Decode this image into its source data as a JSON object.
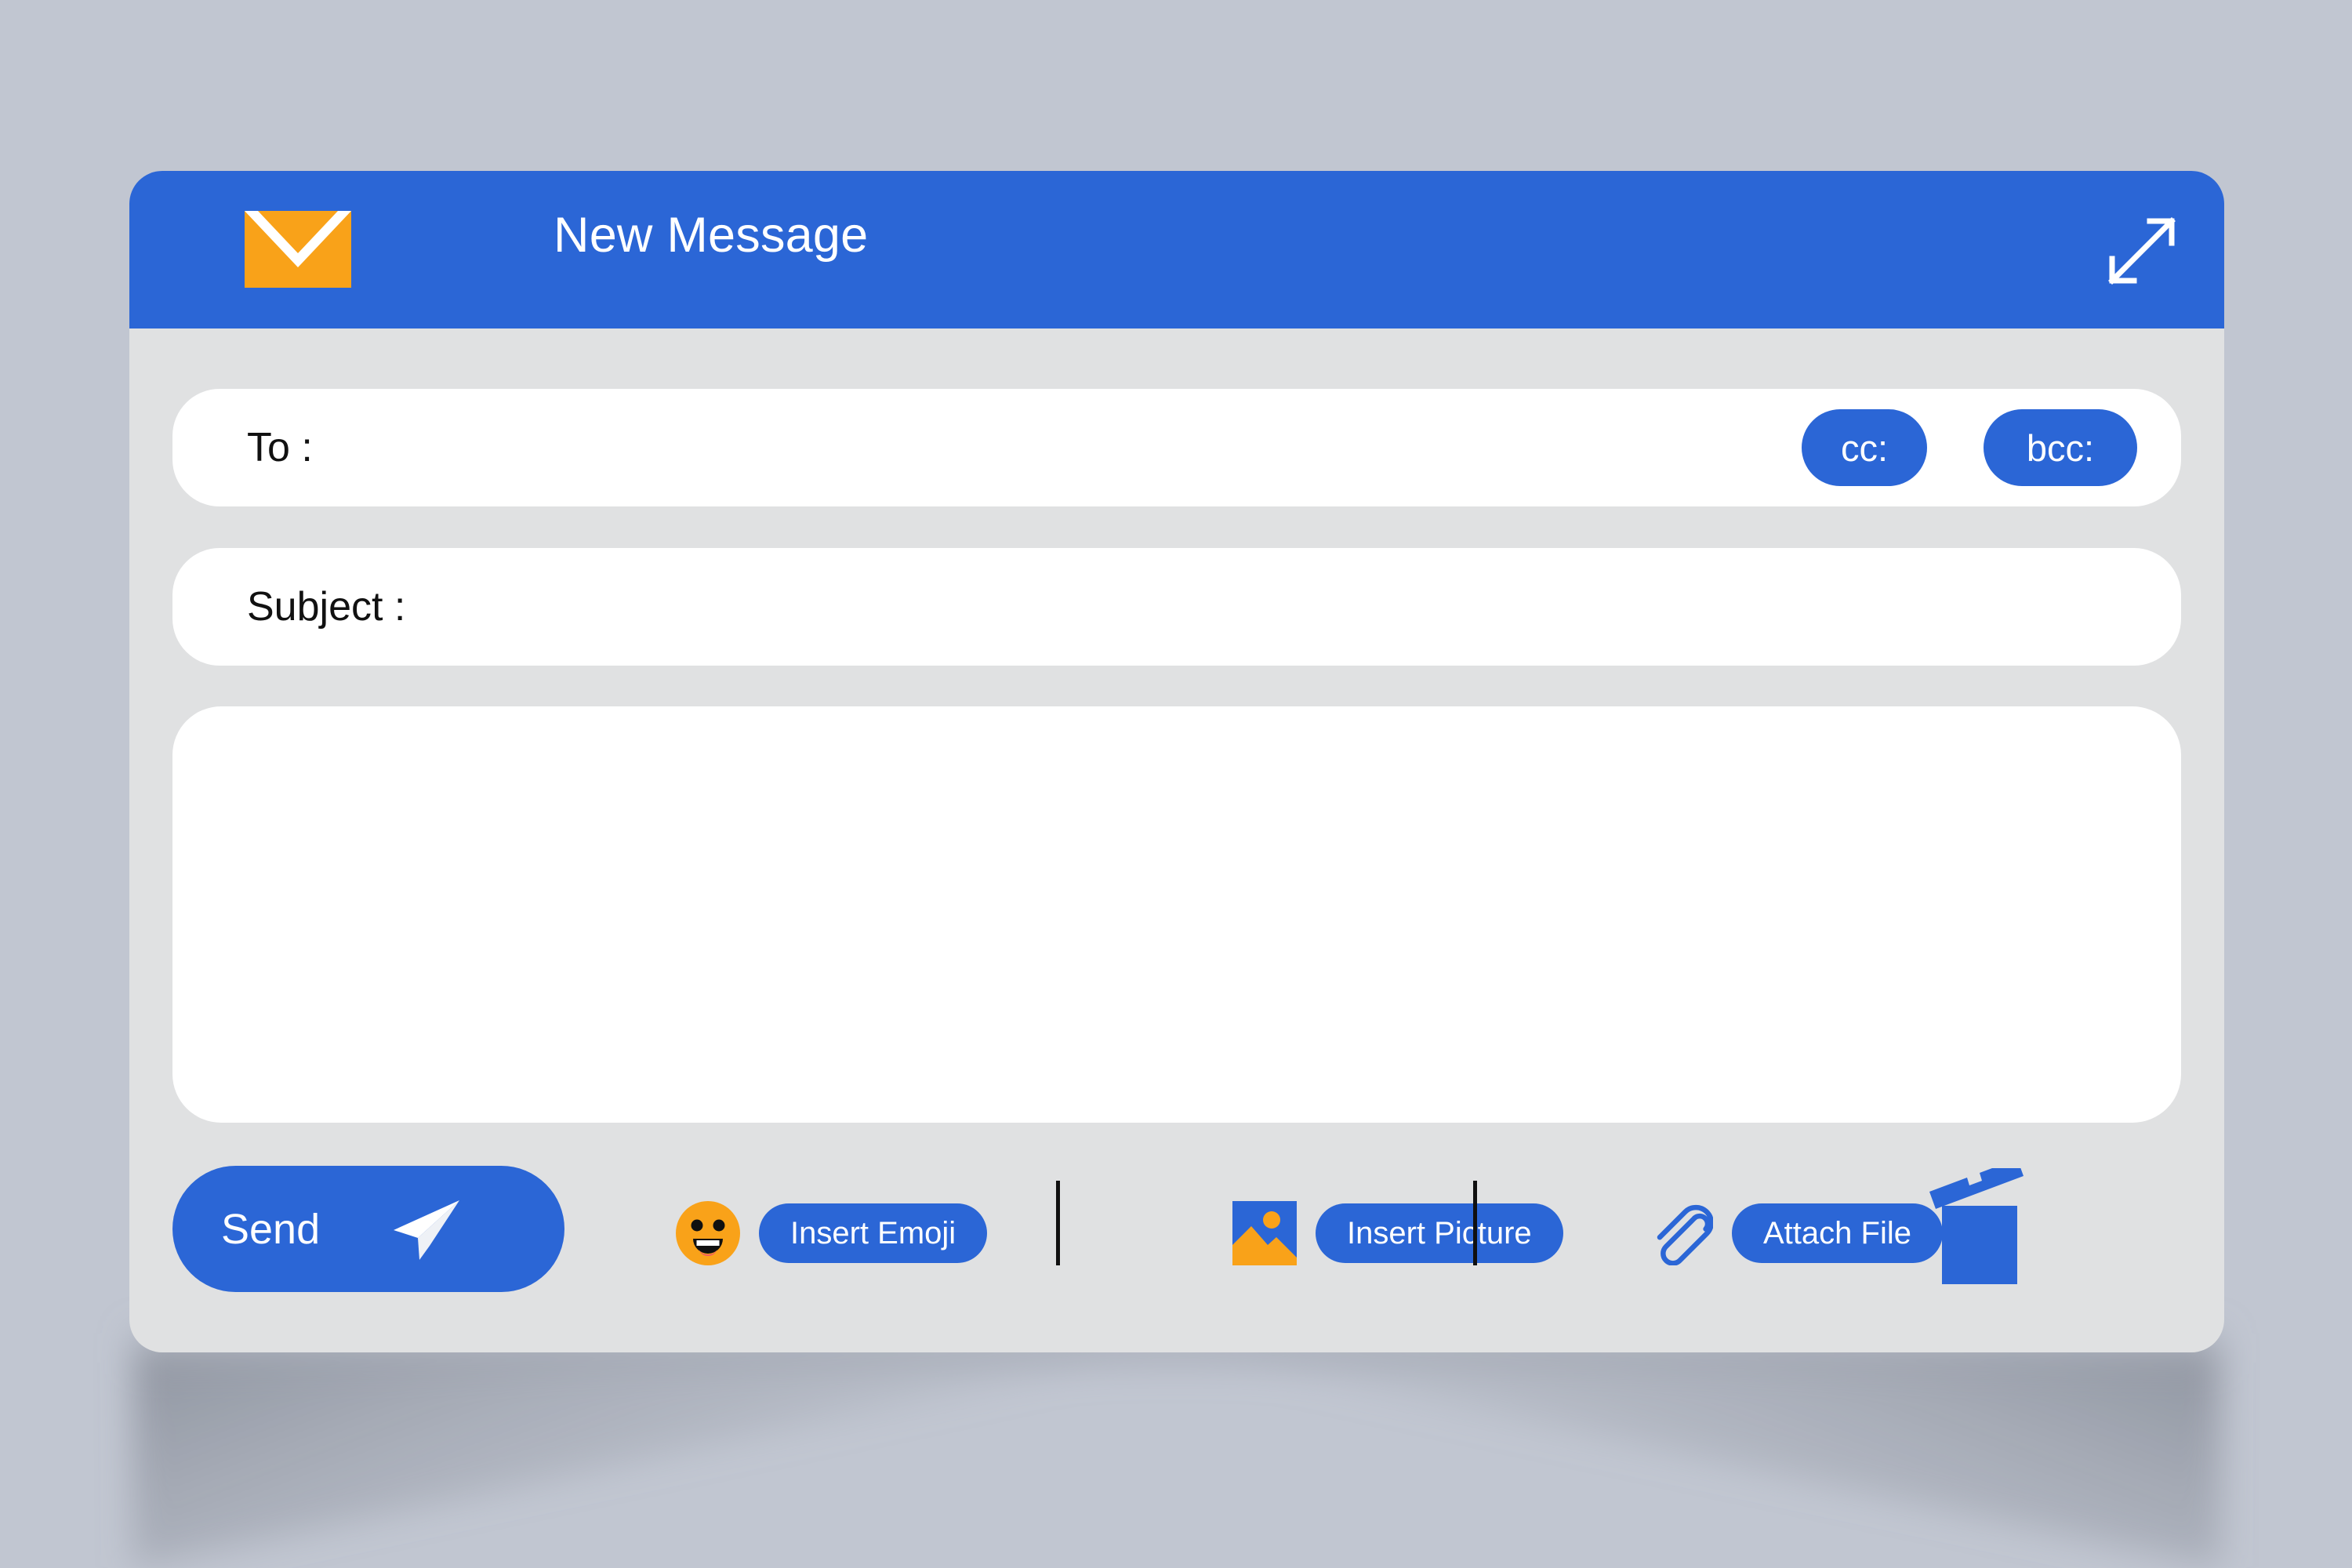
{
  "theme": {
    "page_background": "#c1c6d1",
    "window_background": "#e0e1e2",
    "accent_blue": "#2b66d6",
    "accent_orange": "#f9a219",
    "field_white": "#ffffff",
    "text_dark": "#111111",
    "text_light": "#ffffff",
    "divider": "#101010"
  },
  "titlebar": {
    "title": "New Message",
    "envelope_icon": "envelope-icon",
    "expand_icon": "expand-arrows-icon"
  },
  "form": {
    "to": {
      "label": "To :",
      "value": "",
      "placeholder": ""
    },
    "subject": {
      "label": "Subject :",
      "value": "",
      "placeholder": ""
    },
    "recipients": {
      "cc_label": "cc:",
      "bcc_label": "bcc:"
    },
    "body": {
      "value": "",
      "placeholder": ""
    }
  },
  "toolbar": {
    "send_label": "Send",
    "send_icon": "paper-plane-icon",
    "tools": [
      {
        "icon": "smiley-face-icon",
        "label": "Insert Emoji"
      },
      {
        "icon": "picture-icon",
        "label": "Insert Picture"
      },
      {
        "icon": "paperclip-icon",
        "label": "Attach File"
      }
    ],
    "delete_icon": "trash-can-icon"
  }
}
